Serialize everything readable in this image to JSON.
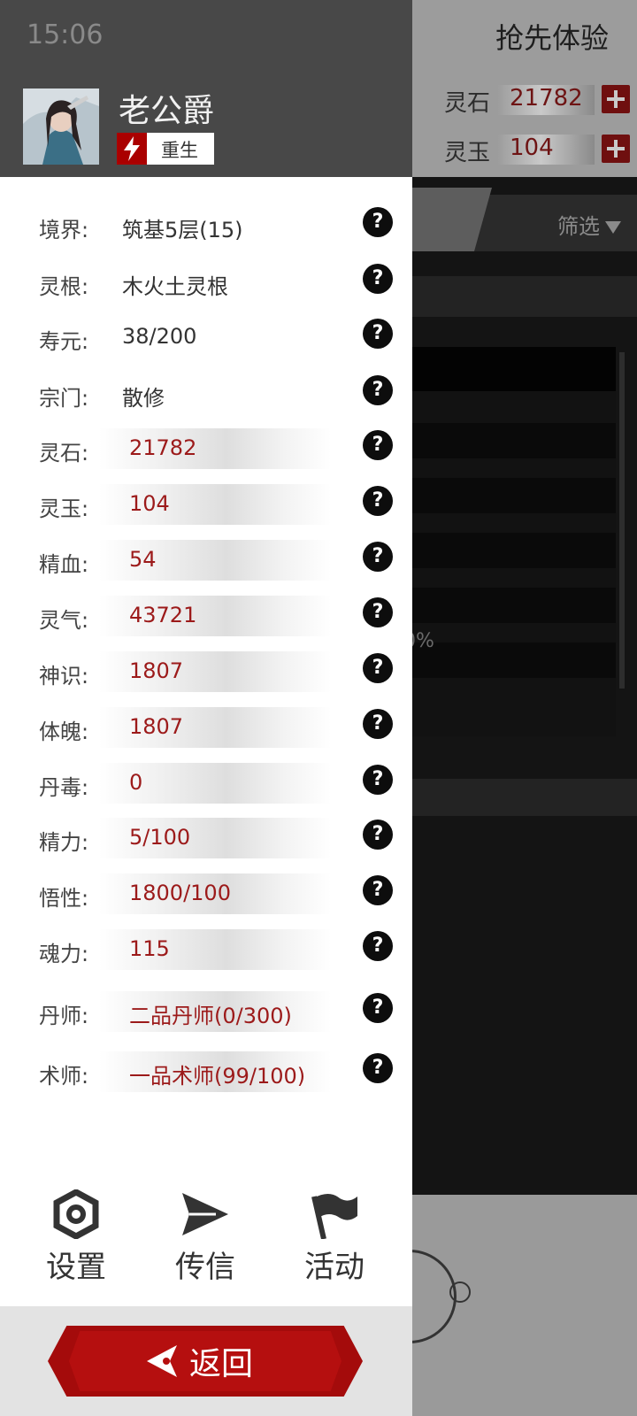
{
  "status": {
    "time": "15:06"
  },
  "background": {
    "title": "抢先体验",
    "resources": [
      {
        "label": "灵石",
        "value": "21782"
      },
      {
        "label": "灵玉",
        "value": "104"
      }
    ],
    "filter_label": "筛选",
    "percent_fragment": "0%"
  },
  "profile": {
    "name": "老公爵",
    "badge": "重生"
  },
  "stats": [
    {
      "key": "境界:",
      "value": "筑基5层(15)",
      "style": "plain"
    },
    {
      "key": "灵根:",
      "value": "木火土灵根",
      "style": "plain"
    },
    {
      "key": "寿元:",
      "value": "38/200",
      "style": "plain"
    },
    {
      "key": "宗门:",
      "value": "散修",
      "style": "plain"
    },
    {
      "key": "灵石:",
      "value": "21782",
      "style": "bar"
    },
    {
      "key": "灵玉:",
      "value": "104",
      "style": "bar"
    },
    {
      "key": "精血:",
      "value": "54",
      "style": "bar"
    },
    {
      "key": "灵气:",
      "value": "43721",
      "style": "bar"
    },
    {
      "key": "神识:",
      "value": "1807",
      "style": "bar"
    },
    {
      "key": "体魄:",
      "value": "1807",
      "style": "bar"
    },
    {
      "key": "丹毒:",
      "value": "0",
      "style": "bar"
    },
    {
      "key": "精力:",
      "value": "5/100",
      "style": "bar"
    },
    {
      "key": "悟性:",
      "value": "1800/100",
      "style": "bar"
    },
    {
      "key": "魂力:",
      "value": "115",
      "style": "bar"
    },
    {
      "key": "丹师:",
      "value": "二品丹师(0/300)",
      "style": "bar"
    },
    {
      "key": "术师:",
      "value": "一品术师(99/100)",
      "style": "bar"
    }
  ],
  "help_glyph": "?",
  "bottom_nav": [
    {
      "label": "设置",
      "icon": "gear-icon"
    },
    {
      "label": "传信",
      "icon": "send-icon"
    },
    {
      "label": "活动",
      "icon": "flag-icon"
    }
  ],
  "back_label": "返回"
}
